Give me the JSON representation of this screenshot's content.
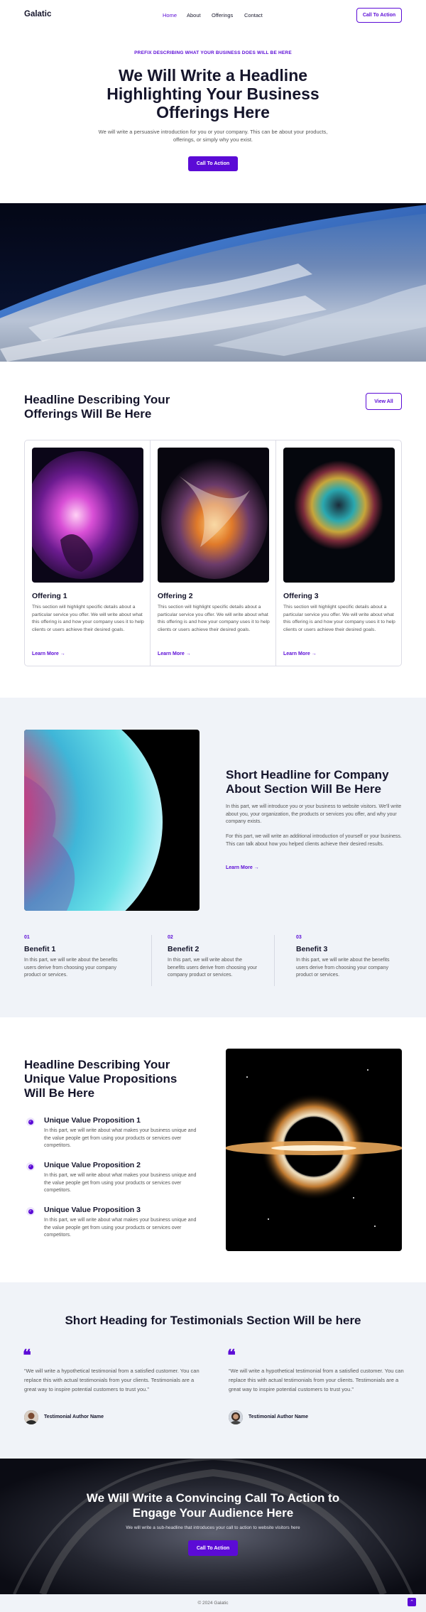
{
  "header": {
    "logo": "Galatic",
    "nav": [
      "Home",
      "About",
      "Offerings",
      "Contact"
    ],
    "cta": "Call To Action"
  },
  "hero": {
    "eyebrow": "PREFIX DESCRIBING WHAT YOUR BUSINESS DOES WILL BE HERE",
    "title": "We Will Write a Headline Highlighting Your Business Offerings Here",
    "lead": "We will write a persuasive introduction for you or your company. This can be about your products, offerings, or simply why you exist.",
    "cta": "Call To Action"
  },
  "offerings": {
    "title": "Headline Describing Your Offerings Will Be Here",
    "view_all": "View All",
    "items": [
      {
        "title": "Offering 1",
        "desc": "This section will highlight specific details about a particular service you offer. We will write about what this offering is and how your company uses it to help clients or users achieve their desired goals.",
        "link": "Learn More"
      },
      {
        "title": "Offering 2",
        "desc": "This section will highlight specific details about a particular service you offer. We will write about what this offering is and how your company uses it to help clients or users achieve their desired goals.",
        "link": "Learn More"
      },
      {
        "title": "Offering 3",
        "desc": "This section will highlight specific details about a particular service you offer. We will write about what this offering is and how your company uses it to help clients or users achieve their desired goals.",
        "link": "Learn More"
      }
    ]
  },
  "about": {
    "title": "Short Headline for Company About Section Will Be Here",
    "p1": "In this part, we will introduce you or your business to website visitors. We'll write about you, your organization, the products or services you offer, and why your company exists.",
    "p2": "For this part, we will write an additional introduction of yourself or your business. This can talk about how you helped clients achieve their desired results.",
    "link": "Learn More",
    "benefits": [
      {
        "num": "01",
        "title": "Benefit 1",
        "desc": "In this part, we will write about the benefits users derive from choosing your company product or services."
      },
      {
        "num": "02",
        "title": "Benefit 2",
        "desc": "In this part, we will write about the benefits users derive from choosing your company product or services."
      },
      {
        "num": "03",
        "title": "Benefit 3",
        "desc": "In this part, we will write about the benefits users derive from choosing your company product or services."
      }
    ]
  },
  "uvp": {
    "title": "Headline Describing Your Unique Value Propositions Will Be Here",
    "items": [
      {
        "title": "Unique Value Proposition 1",
        "desc": "In this part, we will write about what makes your business unique and the value people get from using your products or services over competitors."
      },
      {
        "title": "Unique Value Proposition 2",
        "desc": "In this part, we will write about what makes your business unique and the value people get from using your products or services over competitors."
      },
      {
        "title": "Unique Value Proposition 3",
        "desc": "In this part, we will write about what makes your business unique and the value people get from using your products or services over competitors."
      }
    ]
  },
  "testimonials": {
    "title": "Short Heading for Testimonials Section Will be here",
    "items": [
      {
        "quote": "“We will write a hypothetical testimonial from a satisfied customer. You can replace this with actual testimonials from your clients. Testimonials are a great way to inspire potential customers to trust you.”",
        "author": "Testimonial Author Name"
      },
      {
        "quote": "“We will write a hypothetical testimonial from a satisfied customer. You can replace this with actual testimonials from your clients. Testimonials are a great way to inspire potential customers to trust you.”",
        "author": "Testimonial Author Name"
      }
    ]
  },
  "cta": {
    "title": "We Will Write a Convincing Call To Action to Engage Your Audience Here",
    "sub": "We will write a sub-headline that introduces your call to action to website visitors here",
    "button": "Call To Action"
  },
  "footer": {
    "copyright": "© 2024 Galatic"
  },
  "colors": {
    "accent": "#5b0bd6",
    "section_bg": "#f0f3f8"
  }
}
